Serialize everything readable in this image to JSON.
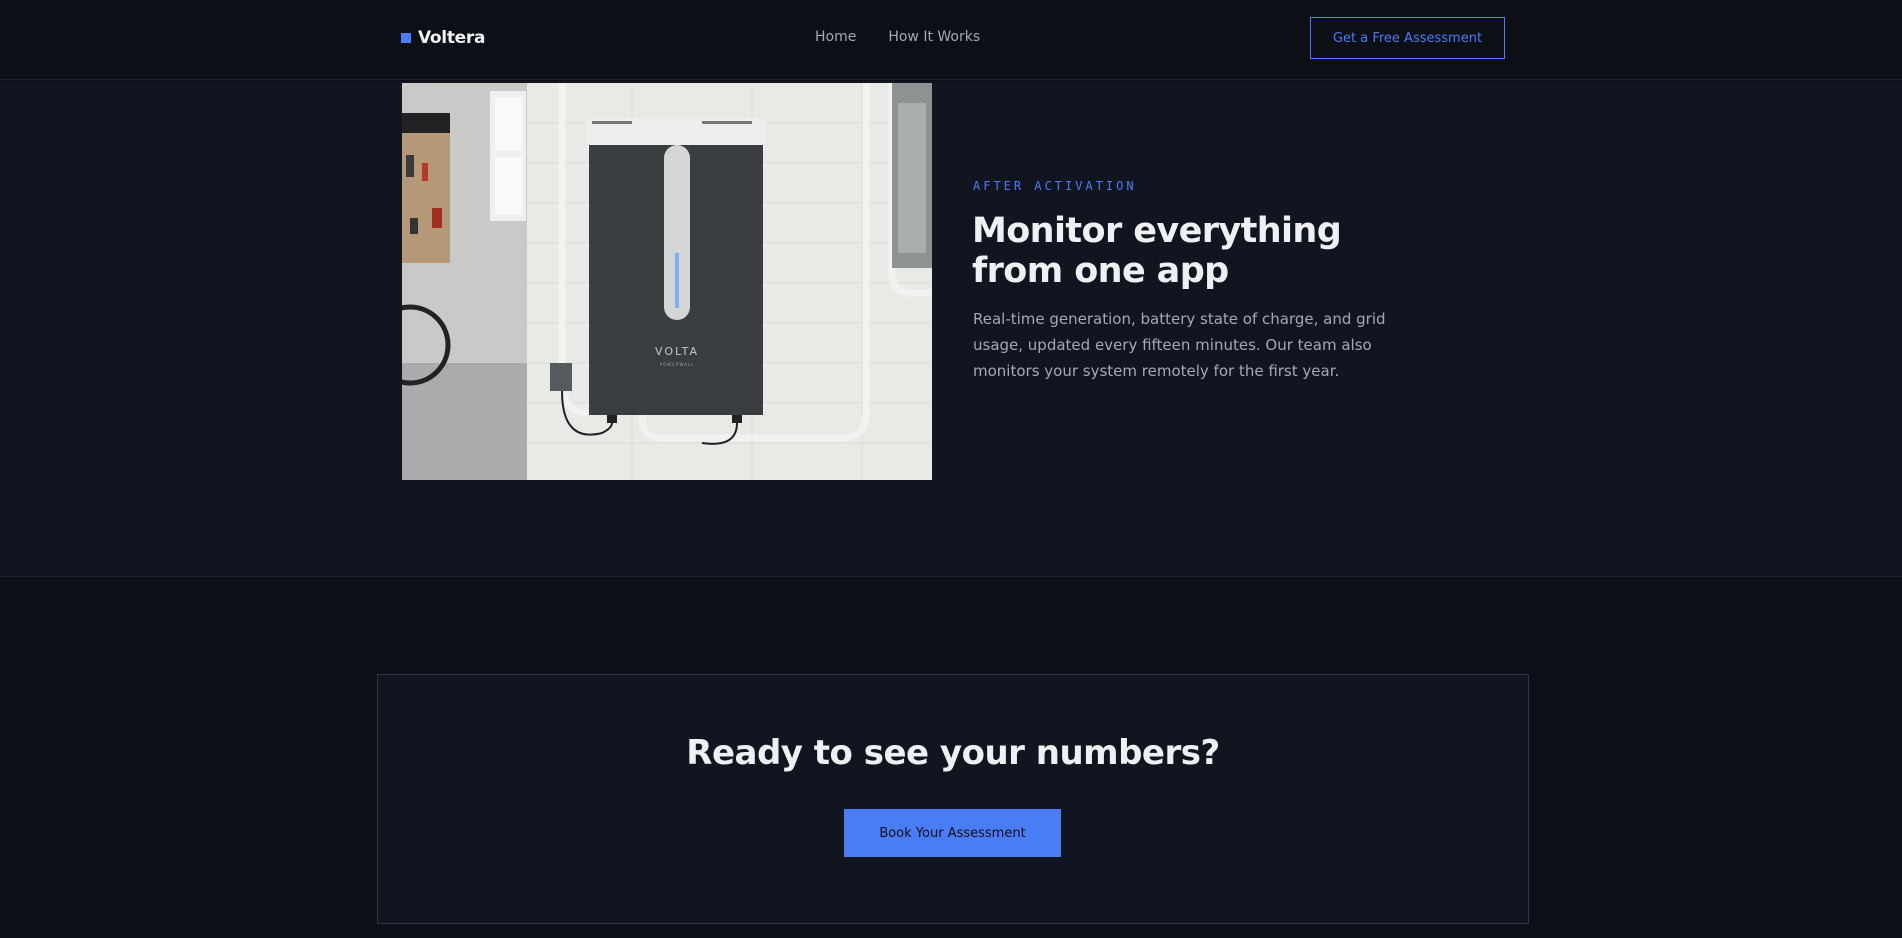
{
  "header": {
    "brand": "Voltera",
    "nav": [
      {
        "label": "Home"
      },
      {
        "label": "How It Works"
      }
    ],
    "cta_label": "Get a Free Assessment"
  },
  "feature": {
    "image_alt": "Wall-mounted home battery unit in a garage",
    "device_brand": "VOLTA",
    "device_sub": "POWERWALL",
    "eyebrow": "AFTER ACTIVATION",
    "headline": "Monitor everything from one app",
    "body": "Real-time generation, battery state of charge, and grid usage, updated every fifteen minutes. Our team also monitors your system remotely for the first year."
  },
  "cta": {
    "title": "Ready to see your numbers?",
    "button_label": "Book Your Assessment"
  },
  "colors": {
    "accent": "#4a7cf6",
    "background": "#0c0f15",
    "section": "#111520"
  }
}
